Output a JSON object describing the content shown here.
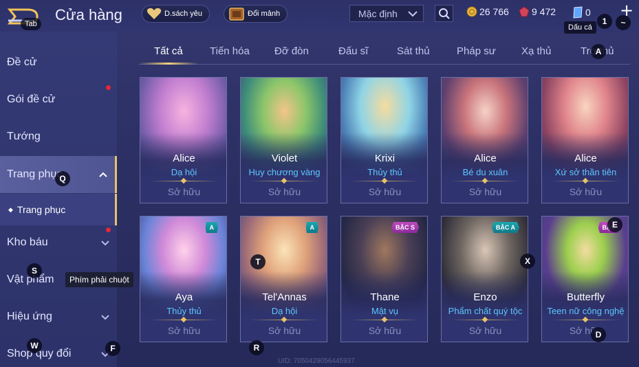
{
  "header": {
    "tab_hint": "Tab",
    "title": "Cửa hàng",
    "wishlist_label": "D.sách yêu",
    "exchange_label": "Đổi mảnh",
    "sort_selected": "Mặc định",
    "gold": "26 766",
    "diamonds": "9 472",
    "vouchers": "0",
    "tilde_hint": "~",
    "key_one": "1",
    "tooltip_tilde": "Dấu cá"
  },
  "sidebar": {
    "items": [
      {
        "label": "Đề cử"
      },
      {
        "label": "Gói đề cử"
      },
      {
        "label": "Tướng"
      },
      {
        "label": "Trang phục"
      },
      {
        "label": "Kho báu"
      },
      {
        "label": "Vật phẩm"
      },
      {
        "label": "Hiệu ứng"
      },
      {
        "label": "Shop quy đổi"
      }
    ],
    "sub_item": "Trang phục"
  },
  "tabs": [
    "Tất cả",
    "Tiến hóa",
    "Đỡ đòn",
    "Đấu sĩ",
    "Sát thủ",
    "Pháp sư",
    "Xạ thủ",
    "Trợ thủ"
  ],
  "cards": [
    {
      "hero": "Alice",
      "skin": "Dạ hội",
      "status": "Sở hữu",
      "badge": ""
    },
    {
      "hero": "Violet",
      "skin": "Huy chương vàng",
      "status": "Sở hữu",
      "badge": ""
    },
    {
      "hero": "Krixi",
      "skin": "Thủy thủ",
      "status": "Sở hữu",
      "badge": ""
    },
    {
      "hero": "Alice",
      "skin": "Bé du xuân",
      "status": "Sở hữu",
      "badge": ""
    },
    {
      "hero": "Alice",
      "skin": "Xứ sở thần tiên",
      "status": "Sở hữu",
      "badge": ""
    },
    {
      "hero": "Aya",
      "skin": "Thủy thủ",
      "status": "Sở hữu",
      "badge": "A"
    },
    {
      "hero": "Tel'Annas",
      "skin": "Dạ hội",
      "status": "Sở hữu",
      "badge": "A"
    },
    {
      "hero": "Thane",
      "skin": "Mật vụ",
      "status": "Sở hữu",
      "badge": "BẬC S"
    },
    {
      "hero": "Enzo",
      "skin": "Phẩm chất quý tộc",
      "status": "Sở hữu",
      "badge": "BẬC A"
    },
    {
      "hero": "Butterfly",
      "skin": "Teen nữ công nghệ",
      "status": "Sở hữu",
      "badge": "BẬC"
    }
  ],
  "key_overlays": {
    "q": "Q",
    "s": "S",
    "w": "W",
    "f": "F",
    "r": "R",
    "t": "T",
    "x": "X",
    "e": "E",
    "d": "D",
    "a": "A"
  },
  "tooltip_right_click": "Phím phải chuột",
  "uid": "UID: 7050429056445937",
  "colors": {
    "accent_gold": "#e7c26a",
    "skin_name_blue": "#5ec6ff",
    "notification_red": "#e6263a"
  }
}
